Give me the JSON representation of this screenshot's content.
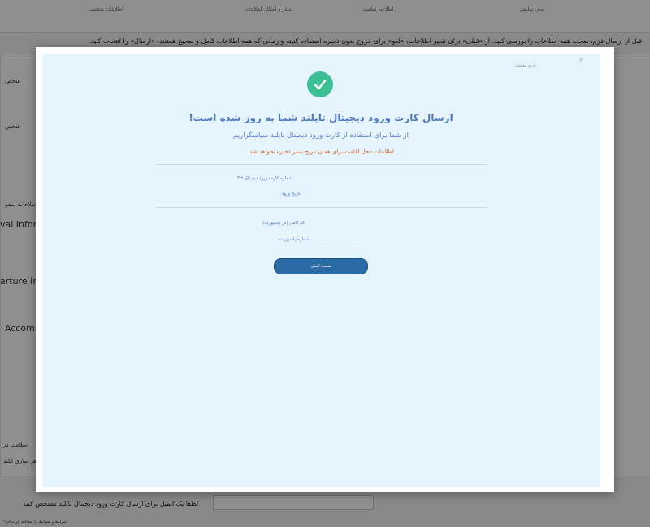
{
  "background": {
    "steps": [
      "پیش نمایش",
      "اطلاعیه سلامت",
      "سفر و اسکان اطلاعات",
      "اطلاعات شخصی"
    ],
    "notice": "قبل از ارسال فرم، صحت همه اطلاعات را بررسی کنید. از «قبلی» برای تغییر اطلاعات، «لغو» برای خروج بدون ذخیره استفاده کنید، و زمانی که همه اطلاعات کامل و صحیح هستند، «ارسال» را انتخاب کنید.",
    "person_label_1": "شخص",
    "person_label_2": "شخص",
    "travel_info_label": "اطلاعات سفر",
    "arrival_heading": "val Inform",
    "departure_heading": "arture Inf",
    "accommodation_heading": "Accomm",
    "health_label": "سلامت در",
    "declaration_text": "جواهر سازی ایلند.",
    "email_prompt": "لطفا یک ایمیل برای ارسال کارت ورود دیجیتال تایلند مشخص کنید",
    "footer_note": "* شرایط و ضوابط را مطالعه کرده ام"
  },
  "modal": {
    "close": "×",
    "transaction_date_label": "تاریخ معامله:",
    "success_icon": "check-circle-icon",
    "title": "ارسال کارت ورود دیجیتال تایلند شما به روز شده است!",
    "subtitle": "از شما برای استفاده از کارت ورود دیجیتال تایلند سپاسگزاریم",
    "warning": "اطلاعات محل اقامت برای همان تاریخ سفر ذخیره نخواهد شد.",
    "card_number_label": "شماره کارت ورود دیجیتال TH:",
    "arrival_date_label": "تاریخ ورود:",
    "full_name_label": "نام کامل (در پاسپورت):",
    "passport_number_label": "شماره پاسپورت:",
    "home_button": "صفحه اصلی"
  },
  "colors": {
    "accent": "#4f7ac7",
    "success": "#3dbf95",
    "warning": "#d65a2b",
    "button": "#2a6aa5",
    "modal_panel": "#e6f4fe"
  }
}
